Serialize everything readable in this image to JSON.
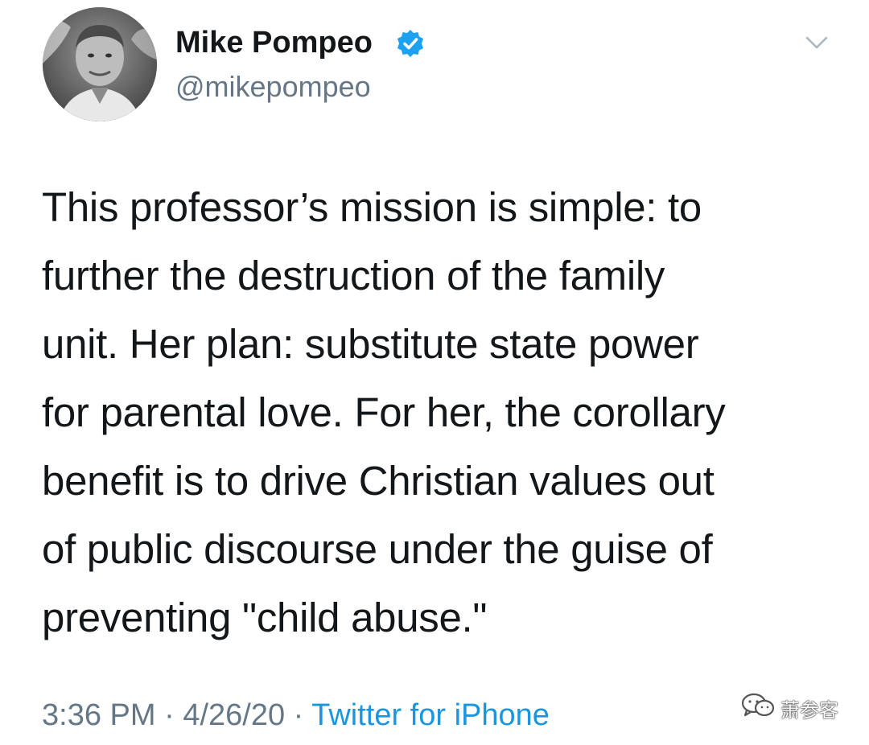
{
  "tweet": {
    "display_name": "Mike Pompeo",
    "handle": "@mikepompeo",
    "verified": true,
    "text_lines": [
      "This professor’s mission is simple: to",
      "further the destruction of the family",
      "unit. Her plan: substitute state power",
      "for parental love. For her, the corollary",
      "benefit is to drive Christian values out",
      "of public discourse under the guise of",
      "preventing \"child abuse.\""
    ],
    "time": "3:36 PM",
    "separator": "·",
    "date": "4/26/20",
    "source": "Twitter for iPhone"
  },
  "icons": {
    "verified": "verified-badge-icon",
    "menu": "chevron-down-icon",
    "watermark": "wechat-icon"
  },
  "watermark": {
    "text": "萧参客"
  },
  "colors": {
    "text": "#14171a",
    "secondary": "#657786",
    "link": "#1b95e0",
    "verified": "#1da1f2"
  }
}
